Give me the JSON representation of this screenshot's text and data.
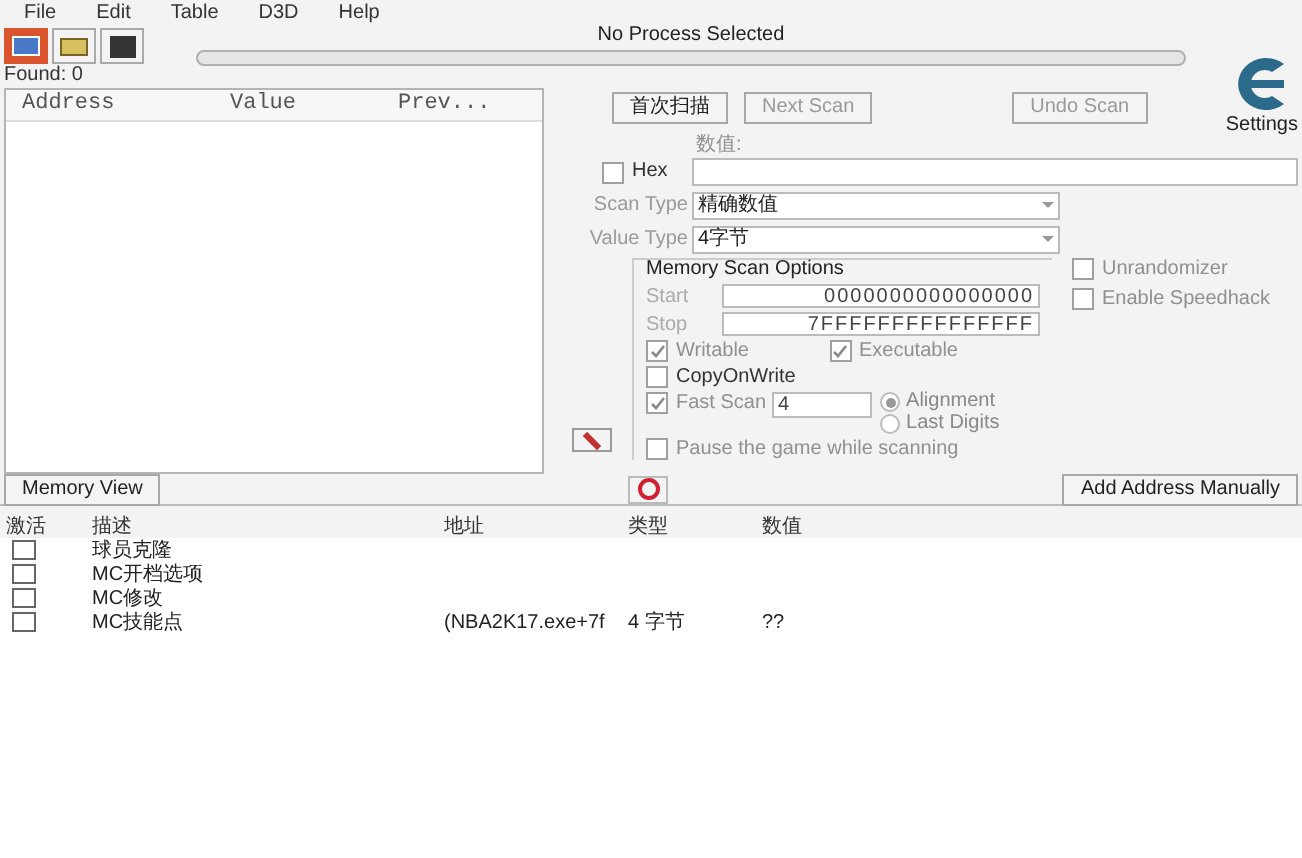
{
  "menu": [
    "File",
    "Edit",
    "Table",
    "D3D",
    "Help"
  ],
  "process_title": "No Process Selected",
  "progress": {
    "level": 0
  },
  "found": "Found: 0",
  "results_columns": [
    "Address",
    "Value",
    "Prev..."
  ],
  "scan_buttons": [
    {
      "label": "首次扫描",
      "disabled": false
    },
    {
      "label": "Next Scan",
      "disabled": true
    },
    {
      "label": "Undo Scan",
      "disabled": true
    }
  ],
  "settings_label": "Settings",
  "value_label": "数值:",
  "hex": {
    "label": "Hex",
    "checked": false
  },
  "scan_type": {
    "label": "Scan Type",
    "value": "精确数值"
  },
  "value_type": {
    "label": "Value Type",
    "value": "4字节"
  },
  "memory_scan_options": {
    "title": "Memory Scan Options",
    "start_label": "Start",
    "start": "0000000000000000",
    "stop_label": "Stop",
    "stop": "7FFFFFFFFFFFFFFF",
    "writable": {
      "label": "Writable",
      "checked": true
    },
    "executable": {
      "label": "Executable",
      "checked": true
    },
    "copy_on_write": {
      "label": "CopyOnWrite",
      "checked": false
    },
    "fast_scan": {
      "label": "Fast Scan",
      "checked": true,
      "value": "4"
    },
    "alignment": [
      {
        "label": "Alignment",
        "selected": true
      },
      {
        "label": "Last Digits",
        "selected": false
      }
    ],
    "pause": {
      "label": "Pause the game while scanning",
      "checked": false
    }
  },
  "unrandomizer": {
    "label": "Unrandomizer",
    "checked": false
  },
  "speedhack": {
    "label": "Enable Speedhack",
    "checked": false
  },
  "memory_view": "Memory View",
  "add_address": "Add Address Manually",
  "table_columns": [
    "激活",
    "描述",
    "地址",
    "类型",
    "数值"
  ],
  "table_rows": [
    {
      "active": false,
      "description": "球员克隆"
    },
    {
      "active": false,
      "description": "MC开档选项"
    },
    {
      "active": false,
      "description": "MC修改"
    },
    {
      "active": false,
      "description": "MC技能点",
      "address": "(NBA2K17.exe+7f",
      "type": "4 字节",
      "value": "??"
    }
  ]
}
